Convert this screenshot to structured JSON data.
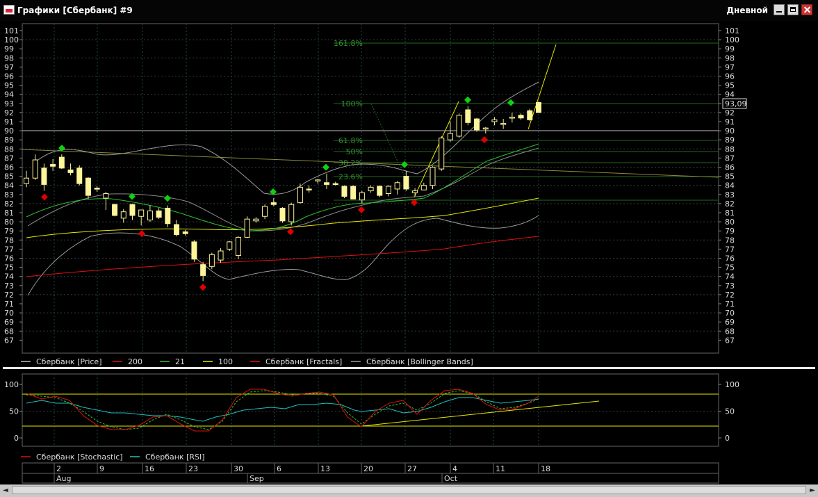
{
  "window": {
    "title": "Графики [Сбербанк] #9",
    "mode": "Дневной"
  },
  "colors": {
    "background": "#000000",
    "candle_up": "#fff59a",
    "candle_down": "#fff59a",
    "ma200": "#e01010",
    "ma21": "#2ec22e",
    "ma100": "#e8e800",
    "bollinger": "#9a9a9a",
    "fractal_up": "#10d010",
    "fractal_down": "#e00000",
    "stochastic": "#e01010",
    "rsi": "#20c0c0",
    "fib": "#2f8f2f"
  },
  "price_axis": {
    "ticks": [
      "101",
      "100",
      "99",
      "98",
      "97",
      "96",
      "95",
      "94",
      "93",
      "92",
      "91",
      "90",
      "89",
      "88",
      "87",
      "86",
      "85",
      "84",
      "83",
      "82",
      "81",
      "80",
      "79",
      "78",
      "77",
      "76",
      "75",
      "74",
      "73",
      "72",
      "71",
      "70",
      "69",
      "68",
      "67"
    ],
    "current_price": "93,09"
  },
  "fib_labels": [
    "161.8%",
    "100%",
    "61.8%",
    "50%",
    "38.2%",
    "23.6%"
  ],
  "legend_main": [
    {
      "label": "Сбербанк [Price]",
      "color": "#bbbbbb"
    },
    {
      "label": "200",
      "color": "#e01010"
    },
    {
      "label": "21",
      "color": "#2ec22e"
    },
    {
      "label": "100",
      "color": "#e8e800"
    },
    {
      "label": "Сбербанк [Fractals]",
      "color": "#e01010"
    },
    {
      "label": "Сбербанк [Bollinger Bands]",
      "color": "#9a9a9a"
    }
  ],
  "osc_axis": {
    "ticks": [
      "100",
      "50",
      "0"
    ]
  },
  "legend_osc": [
    {
      "label": "Сбербанк [Stochastic]",
      "color": "#e01010"
    },
    {
      "label": "Сбербанк [RSI]",
      "color": "#20c0c0"
    }
  ],
  "date_axis": {
    "days": [
      "2",
      "9",
      "16",
      "23",
      "30",
      "6",
      "13",
      "20",
      "27",
      "4",
      "11",
      "18"
    ],
    "months": [
      "Aug",
      "Sep",
      "Oct"
    ]
  },
  "chart_data": {
    "type": "candlestick",
    "candles": [
      {
        "o": 84.2,
        "h": 85.6,
        "l": 83.8,
        "c": 84.8
      },
      {
        "o": 84.8,
        "h": 87.4,
        "l": 84.6,
        "c": 86.8
      },
      {
        "o": 85.9,
        "h": 86.4,
        "l": 83.4,
        "c": 84.1
      },
      {
        "o": 86.3,
        "h": 86.9,
        "l": 85.6,
        "c": 86.1
      },
      {
        "o": 87.1,
        "h": 87.4,
        "l": 85.8,
        "c": 85.9
      },
      {
        "o": 85.7,
        "h": 86.4,
        "l": 85.1,
        "c": 85.4
      },
      {
        "o": 85.9,
        "h": 86.2,
        "l": 84.0,
        "c": 84.2
      },
      {
        "o": 84.8,
        "h": 84.9,
        "l": 82.5,
        "c": 82.9
      },
      {
        "o": 83.7,
        "h": 83.9,
        "l": 83.3,
        "c": 83.6
      },
      {
        "o": 82.6,
        "h": 83.3,
        "l": 81.3,
        "c": 83.1
      },
      {
        "o": 81.9,
        "h": 82.0,
        "l": 80.6,
        "c": 80.7
      },
      {
        "o": 80.4,
        "h": 81.4,
        "l": 79.9,
        "c": 81.1
      },
      {
        "o": 81.9,
        "h": 82.0,
        "l": 80.2,
        "c": 80.7
      },
      {
        "o": 80.6,
        "h": 81.2,
        "l": 79.6,
        "c": 81.3
      },
      {
        "o": 80.2,
        "h": 81.8,
        "l": 80.0,
        "c": 81.2
      },
      {
        "o": 81.2,
        "h": 81.5,
        "l": 80.3,
        "c": 80.5
      },
      {
        "o": 81.5,
        "h": 81.8,
        "l": 79.4,
        "c": 79.8
      },
      {
        "o": 79.7,
        "h": 80.2,
        "l": 78.4,
        "c": 78.6
      },
      {
        "o": 78.9,
        "h": 79.1,
        "l": 78.5,
        "c": 78.7
      },
      {
        "o": 77.8,
        "h": 78.0,
        "l": 75.6,
        "c": 75.9
      },
      {
        "o": 75.3,
        "h": 75.6,
        "l": 73.5,
        "c": 74.1
      },
      {
        "o": 75.1,
        "h": 76.6,
        "l": 74.8,
        "c": 76.4
      },
      {
        "o": 75.8,
        "h": 77.1,
        "l": 75.5,
        "c": 76.8
      },
      {
        "o": 77.0,
        "h": 77.9,
        "l": 76.8,
        "c": 77.8
      },
      {
        "o": 76.3,
        "h": 78.4,
        "l": 75.9,
        "c": 78.3
      },
      {
        "o": 78.3,
        "h": 80.6,
        "l": 78.2,
        "c": 80.3
      },
      {
        "o": 80.1,
        "h": 80.5,
        "l": 79.9,
        "c": 80.3
      },
      {
        "o": 80.6,
        "h": 81.9,
        "l": 80.3,
        "c": 81.7
      },
      {
        "o": 82.1,
        "h": 82.6,
        "l": 81.7,
        "c": 81.9
      },
      {
        "o": 81.5,
        "h": 81.6,
        "l": 79.9,
        "c": 80.1
      },
      {
        "o": 80.0,
        "h": 82.1,
        "l": 79.6,
        "c": 81.9
      },
      {
        "o": 82.1,
        "h": 84.2,
        "l": 82.0,
        "c": 83.8
      },
      {
        "o": 83.6,
        "h": 84.0,
        "l": 83.2,
        "c": 83.5
      },
      {
        "o": 84.5,
        "h": 84.7,
        "l": 84.2,
        "c": 84.6
      },
      {
        "o": 84.3,
        "h": 85.3,
        "l": 83.6,
        "c": 84.1
      },
      {
        "o": 84.2,
        "h": 84.4,
        "l": 84.0,
        "c": 84.1
      },
      {
        "o": 83.9,
        "h": 84.0,
        "l": 82.6,
        "c": 82.8
      },
      {
        "o": 83.9,
        "h": 84.0,
        "l": 82.5,
        "c": 82.5
      },
      {
        "o": 82.4,
        "h": 83.4,
        "l": 82.0,
        "c": 83.2
      },
      {
        "o": 83.4,
        "h": 84.0,
        "l": 83.2,
        "c": 83.8
      },
      {
        "o": 83.9,
        "h": 84.0,
        "l": 82.7,
        "c": 82.9
      },
      {
        "o": 83.1,
        "h": 84.0,
        "l": 82.8,
        "c": 83.9
      },
      {
        "o": 83.6,
        "h": 84.5,
        "l": 83.0,
        "c": 84.3
      },
      {
        "o": 85.0,
        "h": 85.6,
        "l": 83.4,
        "c": 83.6
      },
      {
        "o": 83.2,
        "h": 83.7,
        "l": 82.8,
        "c": 83.4
      },
      {
        "o": 83.5,
        "h": 84.3,
        "l": 83.5,
        "c": 84.0
      },
      {
        "o": 84.0,
        "h": 86.1,
        "l": 83.6,
        "c": 86.0
      },
      {
        "o": 85.8,
        "h": 89.4,
        "l": 85.6,
        "c": 89.2
      },
      {
        "o": 89.0,
        "h": 91.0,
        "l": 88.8,
        "c": 89.7
      },
      {
        "o": 89.4,
        "h": 91.9,
        "l": 89.2,
        "c": 91.7
      },
      {
        "o": 92.3,
        "h": 92.7,
        "l": 90.6,
        "c": 90.9
      },
      {
        "o": 91.3,
        "h": 91.4,
        "l": 89.9,
        "c": 90.1
      },
      {
        "o": 90.3,
        "h": 90.4,
        "l": 89.7,
        "c": 90.3
      },
      {
        "o": 91.0,
        "h": 91.5,
        "l": 90.6,
        "c": 91.2
      },
      {
        "o": 90.8,
        "h": 91.3,
        "l": 90.2,
        "c": 90.8
      },
      {
        "o": 91.4,
        "h": 92.0,
        "l": 90.9,
        "c": 91.5
      },
      {
        "o": 91.7,
        "h": 91.9,
        "l": 91.2,
        "c": 91.4
      },
      {
        "o": 92.2,
        "h": 92.4,
        "l": 91.1,
        "c": 91.2
      },
      {
        "o": 93.1,
        "h": 93.2,
        "l": 92.0,
        "c": 92.0
      }
    ],
    "ylim": [
      66,
      102
    ],
    "osc_ylim": [
      -20,
      120
    ]
  }
}
